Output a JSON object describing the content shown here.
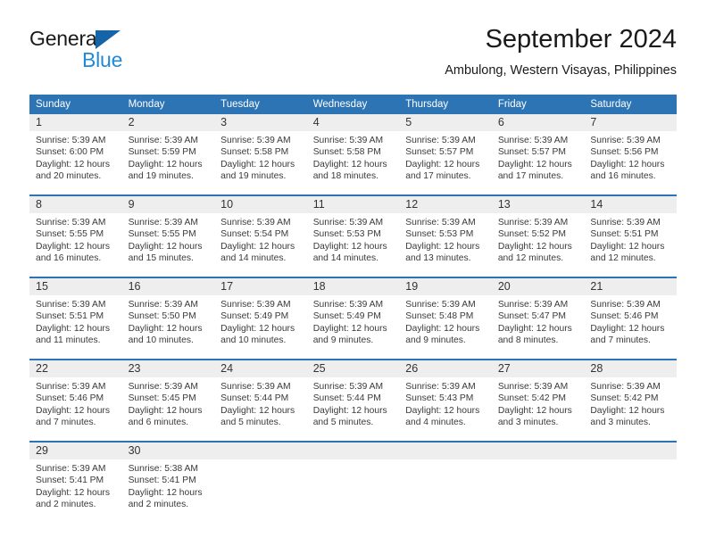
{
  "brand": {
    "name_top": "General",
    "name_bottom": "Blue",
    "logo_icon": "triangle-logo-icon",
    "color_dark": "#1a1a1a",
    "color_blue": "#2089d8",
    "color_triangle": "#1464aa"
  },
  "header": {
    "month_title": "September 2024",
    "location": "Ambulong, Western Visayas, Philippines"
  },
  "theme": {
    "header_blue": "#2d74b5",
    "date_band_gray": "#eeeeee",
    "text_color": "#3a3a3a"
  },
  "weekday_headers": [
    "Sunday",
    "Monday",
    "Tuesday",
    "Wednesday",
    "Thursday",
    "Friday",
    "Saturday"
  ],
  "weeks": [
    [
      {
        "day": "1",
        "sunrise": "Sunrise: 5:39 AM",
        "sunset": "Sunset: 6:00 PM",
        "daylight1": "Daylight: 12 hours",
        "daylight2": "and 20 minutes."
      },
      {
        "day": "2",
        "sunrise": "Sunrise: 5:39 AM",
        "sunset": "Sunset: 5:59 PM",
        "daylight1": "Daylight: 12 hours",
        "daylight2": "and 19 minutes."
      },
      {
        "day": "3",
        "sunrise": "Sunrise: 5:39 AM",
        "sunset": "Sunset: 5:58 PM",
        "daylight1": "Daylight: 12 hours",
        "daylight2": "and 19 minutes."
      },
      {
        "day": "4",
        "sunrise": "Sunrise: 5:39 AM",
        "sunset": "Sunset: 5:58 PM",
        "daylight1": "Daylight: 12 hours",
        "daylight2": "and 18 minutes."
      },
      {
        "day": "5",
        "sunrise": "Sunrise: 5:39 AM",
        "sunset": "Sunset: 5:57 PM",
        "daylight1": "Daylight: 12 hours",
        "daylight2": "and 17 minutes."
      },
      {
        "day": "6",
        "sunrise": "Sunrise: 5:39 AM",
        "sunset": "Sunset: 5:57 PM",
        "daylight1": "Daylight: 12 hours",
        "daylight2": "and 17 minutes."
      },
      {
        "day": "7",
        "sunrise": "Sunrise: 5:39 AM",
        "sunset": "Sunset: 5:56 PM",
        "daylight1": "Daylight: 12 hours",
        "daylight2": "and 16 minutes."
      }
    ],
    [
      {
        "day": "8",
        "sunrise": "Sunrise: 5:39 AM",
        "sunset": "Sunset: 5:55 PM",
        "daylight1": "Daylight: 12 hours",
        "daylight2": "and 16 minutes."
      },
      {
        "day": "9",
        "sunrise": "Sunrise: 5:39 AM",
        "sunset": "Sunset: 5:55 PM",
        "daylight1": "Daylight: 12 hours",
        "daylight2": "and 15 minutes."
      },
      {
        "day": "10",
        "sunrise": "Sunrise: 5:39 AM",
        "sunset": "Sunset: 5:54 PM",
        "daylight1": "Daylight: 12 hours",
        "daylight2": "and 14 minutes."
      },
      {
        "day": "11",
        "sunrise": "Sunrise: 5:39 AM",
        "sunset": "Sunset: 5:53 PM",
        "daylight1": "Daylight: 12 hours",
        "daylight2": "and 14 minutes."
      },
      {
        "day": "12",
        "sunrise": "Sunrise: 5:39 AM",
        "sunset": "Sunset: 5:53 PM",
        "daylight1": "Daylight: 12 hours",
        "daylight2": "and 13 minutes."
      },
      {
        "day": "13",
        "sunrise": "Sunrise: 5:39 AM",
        "sunset": "Sunset: 5:52 PM",
        "daylight1": "Daylight: 12 hours",
        "daylight2": "and 12 minutes."
      },
      {
        "day": "14",
        "sunrise": "Sunrise: 5:39 AM",
        "sunset": "Sunset: 5:51 PM",
        "daylight1": "Daylight: 12 hours",
        "daylight2": "and 12 minutes."
      }
    ],
    [
      {
        "day": "15",
        "sunrise": "Sunrise: 5:39 AM",
        "sunset": "Sunset: 5:51 PM",
        "daylight1": "Daylight: 12 hours",
        "daylight2": "and 11 minutes."
      },
      {
        "day": "16",
        "sunrise": "Sunrise: 5:39 AM",
        "sunset": "Sunset: 5:50 PM",
        "daylight1": "Daylight: 12 hours",
        "daylight2": "and 10 minutes."
      },
      {
        "day": "17",
        "sunrise": "Sunrise: 5:39 AM",
        "sunset": "Sunset: 5:49 PM",
        "daylight1": "Daylight: 12 hours",
        "daylight2": "and 10 minutes."
      },
      {
        "day": "18",
        "sunrise": "Sunrise: 5:39 AM",
        "sunset": "Sunset: 5:49 PM",
        "daylight1": "Daylight: 12 hours",
        "daylight2": "and 9 minutes."
      },
      {
        "day": "19",
        "sunrise": "Sunrise: 5:39 AM",
        "sunset": "Sunset: 5:48 PM",
        "daylight1": "Daylight: 12 hours",
        "daylight2": "and 9 minutes."
      },
      {
        "day": "20",
        "sunrise": "Sunrise: 5:39 AM",
        "sunset": "Sunset: 5:47 PM",
        "daylight1": "Daylight: 12 hours",
        "daylight2": "and 8 minutes."
      },
      {
        "day": "21",
        "sunrise": "Sunrise: 5:39 AM",
        "sunset": "Sunset: 5:46 PM",
        "daylight1": "Daylight: 12 hours",
        "daylight2": "and 7 minutes."
      }
    ],
    [
      {
        "day": "22",
        "sunrise": "Sunrise: 5:39 AM",
        "sunset": "Sunset: 5:46 PM",
        "daylight1": "Daylight: 12 hours",
        "daylight2": "and 7 minutes."
      },
      {
        "day": "23",
        "sunrise": "Sunrise: 5:39 AM",
        "sunset": "Sunset: 5:45 PM",
        "daylight1": "Daylight: 12 hours",
        "daylight2": "and 6 minutes."
      },
      {
        "day": "24",
        "sunrise": "Sunrise: 5:39 AM",
        "sunset": "Sunset: 5:44 PM",
        "daylight1": "Daylight: 12 hours",
        "daylight2": "and 5 minutes."
      },
      {
        "day": "25",
        "sunrise": "Sunrise: 5:39 AM",
        "sunset": "Sunset: 5:44 PM",
        "daylight1": "Daylight: 12 hours",
        "daylight2": "and 5 minutes."
      },
      {
        "day": "26",
        "sunrise": "Sunrise: 5:39 AM",
        "sunset": "Sunset: 5:43 PM",
        "daylight1": "Daylight: 12 hours",
        "daylight2": "and 4 minutes."
      },
      {
        "day": "27",
        "sunrise": "Sunrise: 5:39 AM",
        "sunset": "Sunset: 5:42 PM",
        "daylight1": "Daylight: 12 hours",
        "daylight2": "and 3 minutes."
      },
      {
        "day": "28",
        "sunrise": "Sunrise: 5:39 AM",
        "sunset": "Sunset: 5:42 PM",
        "daylight1": "Daylight: 12 hours",
        "daylight2": "and 3 minutes."
      }
    ],
    [
      {
        "day": "29",
        "sunrise": "Sunrise: 5:39 AM",
        "sunset": "Sunset: 5:41 PM",
        "daylight1": "Daylight: 12 hours",
        "daylight2": "and 2 minutes."
      },
      {
        "day": "30",
        "sunrise": "Sunrise: 5:38 AM",
        "sunset": "Sunset: 5:41 PM",
        "daylight1": "Daylight: 12 hours",
        "daylight2": "and 2 minutes."
      },
      {
        "day": "",
        "sunrise": "",
        "sunset": "",
        "daylight1": "",
        "daylight2": ""
      },
      {
        "day": "",
        "sunrise": "",
        "sunset": "",
        "daylight1": "",
        "daylight2": ""
      },
      {
        "day": "",
        "sunrise": "",
        "sunset": "",
        "daylight1": "",
        "daylight2": ""
      },
      {
        "day": "",
        "sunrise": "",
        "sunset": "",
        "daylight1": "",
        "daylight2": ""
      },
      {
        "day": "",
        "sunrise": "",
        "sunset": "",
        "daylight1": "",
        "daylight2": ""
      }
    ]
  ]
}
